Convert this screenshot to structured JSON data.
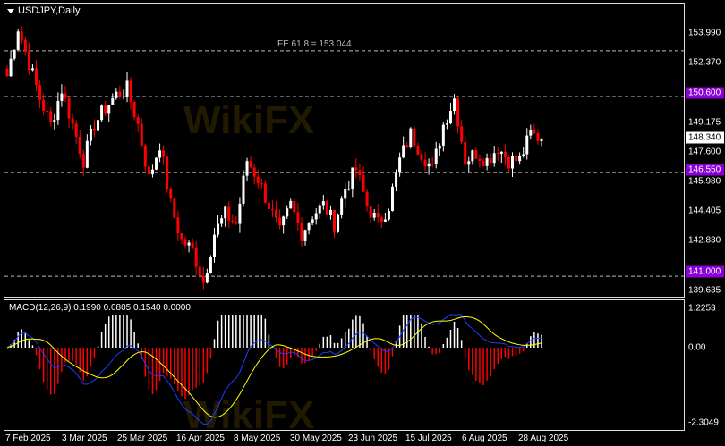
{
  "header": {
    "title": "USDJPY,Daily"
  },
  "annotation": {
    "fe_label": "FE 61.8 = 153.044"
  },
  "watermark": "WikiFX",
  "price_axis": {
    "ticks": [
      "153.990",
      "152.370",
      "149.175",
      "147.600",
      "145.980",
      "144.405",
      "142.830",
      "139.635"
    ],
    "tags": [
      {
        "label": "150.600",
        "color": "#8b00d6"
      },
      {
        "label": "148.340",
        "color": "#ffffff"
      },
      {
        "label": "146.550",
        "color": "#8b00d6"
      },
      {
        "label": "141.000",
        "color": "#8b00d6"
      }
    ]
  },
  "macd": {
    "title": "MACD(12,26,9) 0.1990 0.0805 0.1540 0.0000",
    "ticks": [
      "1.2253",
      "0.00",
      "-2.3049"
    ]
  },
  "x_axis": {
    "labels": [
      "7 Feb 2025",
      "3 Mar 2025",
      "25 Mar 2025",
      "16 Apr 2025",
      "8 May 2025",
      "30 May 2025",
      "23 Jun 2025",
      "15 Jul 2025",
      "6 Aug 2025",
      "28 Aug 2025"
    ]
  },
  "chart_data": {
    "type": "candlestick",
    "symbol": "USDJPY",
    "timeframe": "Daily",
    "ylim": [
      139.635,
      155.2
    ],
    "horizontal_levels": [
      153.044,
      150.6,
      146.55,
      141.0
    ],
    "last_price": 148.34,
    "colors": {
      "bull": "#ffffff",
      "bear": "#ff0000",
      "macd_line": "#1e3cff",
      "signal_line": "#ffff00"
    },
    "key_closes": [
      151.7,
      154.3,
      152.4,
      150.5,
      149.1,
      151.0,
      149.1,
      147.2,
      149.1,
      150.0,
      150.7,
      151.0,
      149.1,
      146.2,
      148.1,
      144.8,
      142.9,
      142.4,
      140.7,
      143.3,
      144.3,
      143.8,
      147.2,
      146.2,
      144.8,
      143.3,
      144.8,
      143.3,
      144.3,
      144.8,
      143.8,
      145.7,
      146.7,
      144.8,
      143.8,
      144.8,
      147.2,
      148.6,
      147.6,
      146.7,
      149.1,
      150.5,
      147.2,
      147.6,
      147.2,
      147.9,
      147.2,
      147.2,
      148.6,
      148.34
    ]
  }
}
